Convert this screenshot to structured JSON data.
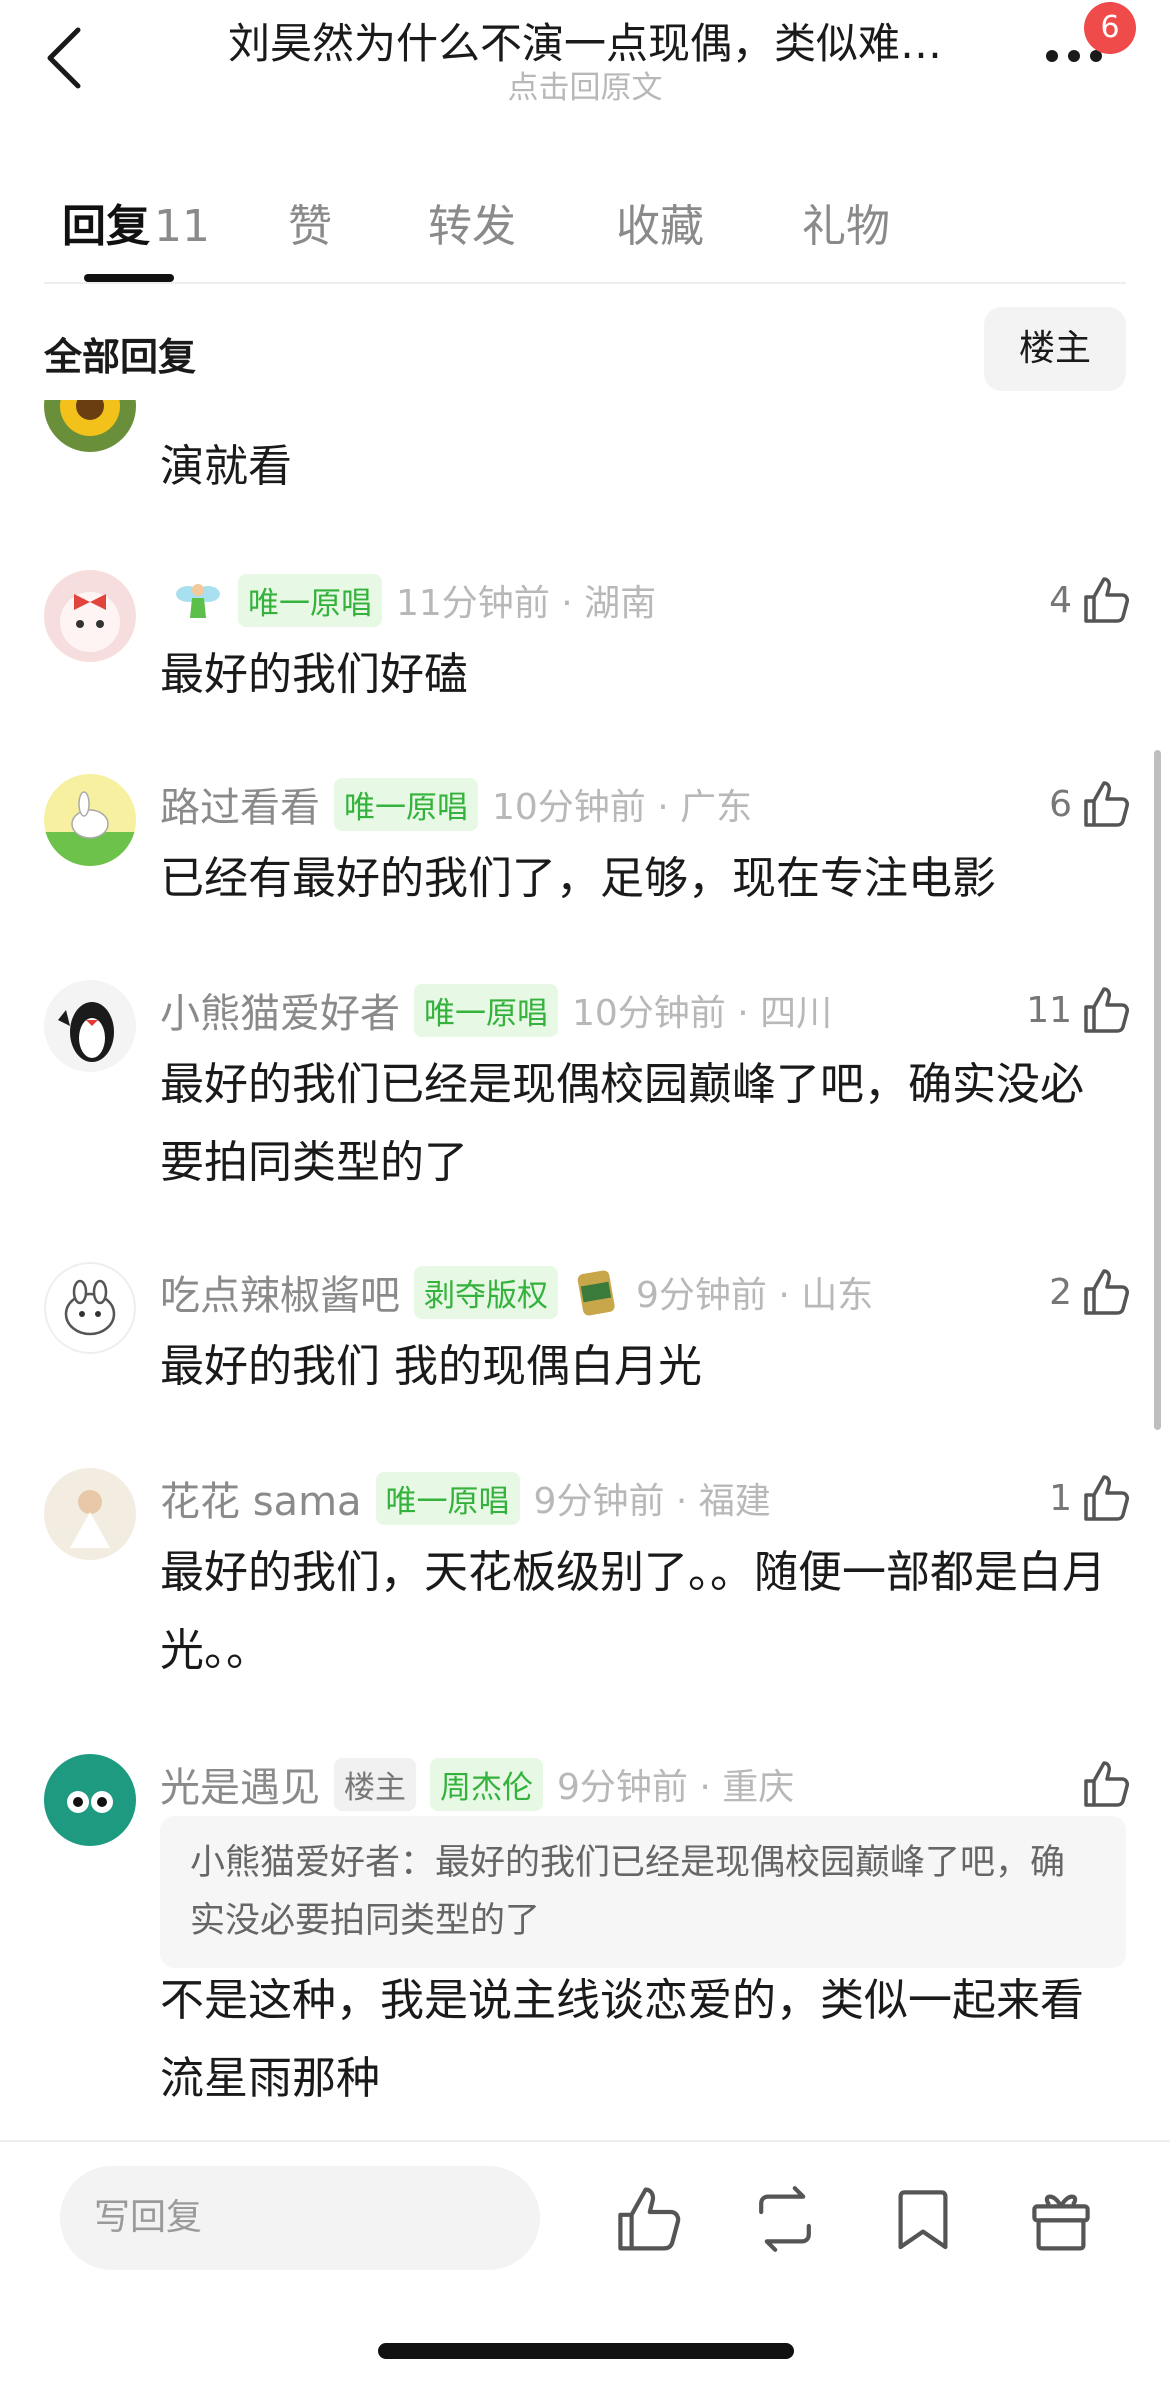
{
  "header": {
    "title": "刘昊然为什么不演一点现偶，类似难…",
    "subtitle": "点击回原文",
    "notification_count": "6"
  },
  "tabs": [
    {
      "label": "回复",
      "count": "11",
      "active": true
    },
    {
      "label": "赞",
      "count": "",
      "active": false
    },
    {
      "label": "转发",
      "count": "",
      "active": false
    },
    {
      "label": "收藏",
      "count": "",
      "active": false
    },
    {
      "label": "礼物",
      "count": "",
      "active": false
    }
  ],
  "filter": {
    "label": "全部回复",
    "owner_button": "楼主"
  },
  "comments": [
    {
      "username": "",
      "text": "演就看",
      "likes": ""
    },
    {
      "username": "",
      "tag": "唯一原唱",
      "time": "11分钟前 · 湖南",
      "text": "最好的我们好磕",
      "likes": "4"
    },
    {
      "username": "路过看看",
      "tag": "唯一原唱",
      "time": "10分钟前 · 广东",
      "text": "已经有最好的我们了，足够，现在专注电影",
      "likes": "6"
    },
    {
      "username": "小熊猫爱好者",
      "tag": "唯一原唱",
      "time": "10分钟前 · 四川",
      "text": "最好的我们已经是现偶校园巅峰了吧，确实没必要拍同类型的了",
      "likes": "11"
    },
    {
      "username": "吃点辣椒酱吧",
      "tag": "剥夺版权",
      "time": "9分钟前 · 山东",
      "text": "最好的我们 我的现偶白月光",
      "likes": "2"
    },
    {
      "username": "花花 sama",
      "tag": "唯一原唱",
      "time": "9分钟前 · 福建",
      "text": "最好的我们，天花板级别了。。随便一部都是白月光。。",
      "likes": "1"
    },
    {
      "username": "光是遇见",
      "owner_tag": "楼主",
      "tag": "周杰伦",
      "time": "9分钟前 · 重庆",
      "quote": "小熊猫爱好者：最好的我们已经是现偶校园巅峰了吧，确实没必要拍同类型的了",
      "text": "不是这种，我是说主线谈恋爱的，类似一起来看流星雨那种",
      "likes": ""
    }
  ],
  "bottom_bar": {
    "reply_placeholder": "写回复"
  },
  "colors": {
    "tag_green_bg": "#e7f8e4",
    "tag_green_text": "#35b23e",
    "badge_red": "#f04b4b"
  },
  "icons": [
    "back-icon",
    "more-icon",
    "thumbs-up-icon",
    "repost-icon",
    "bookmark-icon",
    "gift-icon"
  ]
}
